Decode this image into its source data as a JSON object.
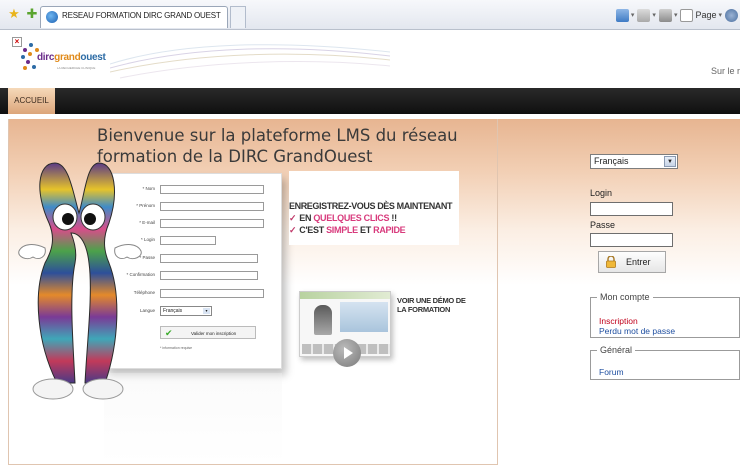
{
  "browser": {
    "tab_title": "RESEAU FORMATION DIRC GRAND OUEST",
    "page_label": "Page"
  },
  "header": {
    "logo_part1": "dirc",
    "logo_part2": "grand",
    "logo_part3": "ouest",
    "logo_subtitle": "LA RECHERCHE CLINIQUE",
    "tagline": "Sur le r"
  },
  "nav": {
    "items": [
      {
        "label": "ACCUEIL"
      }
    ]
  },
  "main": {
    "welcome_title": "Bienvenue sur la plateforme LMS du réseau formation de la DIRC GrandOuest",
    "form_mockup": {
      "fields": [
        {
          "label": "* Nom"
        },
        {
          "label": "* Prénom"
        },
        {
          "label": "* E-mail"
        },
        {
          "label": "* Login"
        },
        {
          "label": "* Passe"
        },
        {
          "label": "* Confirmation"
        },
        {
          "label": "Téléphone"
        }
      ],
      "lang_label": "Langue",
      "lang_value": "Français",
      "validate_label": "Valider mon inscription",
      "required_note": "* information requise"
    },
    "register": {
      "headline": "ENREGISTREZ-VOUS DÈS MAINTENANT",
      "line1_prefix": "EN",
      "line1_highlight": "QUELQUES CLICS",
      "line1_suffix": "!!",
      "line2_prefix": "C'EST",
      "line2_highlight1": "SIMPLE",
      "line2_mid": "ET",
      "line2_highlight2": "RAPIDE"
    },
    "demo": {
      "text": "VOIR UNE DÉMO DE LA FORMATION"
    }
  },
  "login_panel": {
    "language": "Français",
    "login_label": "Login",
    "password_label": "Passe",
    "enter_button": "Entrer",
    "mon_compte": {
      "legend": "Mon compte",
      "inscription": "Inscription",
      "forgot_password": "Perdu mot de passe"
    },
    "general": {
      "legend": "Général",
      "forum": "Forum"
    }
  },
  "colors": {
    "nav_bg": "#1a1a1a",
    "accent_pink": "#d83a7c",
    "link_red": "#c0001a",
    "link_blue": "#1f4fa0"
  }
}
